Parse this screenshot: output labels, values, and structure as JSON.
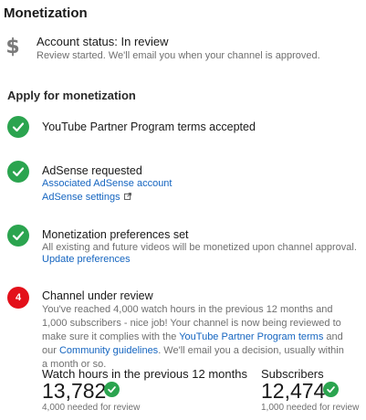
{
  "header": {
    "title": "Monetization"
  },
  "account": {
    "icon": "dollar-icon",
    "status": "Account status: In review",
    "description": "Review started. We'll email you when your channel is approved."
  },
  "apply": {
    "heading": "Apply for monetization",
    "steps": [
      {
        "title": "YouTube Partner Program terms accepted",
        "state": "complete"
      },
      {
        "title": "AdSense requested",
        "state": "complete",
        "links": [
          "Associated AdSense account",
          "AdSense settings"
        ]
      },
      {
        "title": "Monetization preferences set",
        "state": "complete",
        "description": "All existing and future videos will be monetized upon channel approval.",
        "link": "Update preferences"
      },
      {
        "title": "Channel under review",
        "state": "in-progress",
        "step_number": "4",
        "description_part1": "You've reached 4,000 watch hours in the previous 12 months and 1,000 subscribers - nice job! Your channel is now being reviewed to make sure it complies with the",
        "link_terms": "YouTube Partner Program terms",
        "description_part2": "and our",
        "link_guidelines": "Community guidelines",
        "description_part3": ". We'll email you a decision, usually within a month or so."
      }
    ]
  },
  "stats": {
    "watch_hours": {
      "label": "Watch hours in the previous 12 months",
      "value": "13,782",
      "needed": "4,000 needed for review"
    },
    "subscribers": {
      "label": "Subscribers",
      "value": "12,474",
      "needed": "1,000 needed for review"
    }
  },
  "colors": {
    "success_green": "#2ba44f",
    "link_blue": "#1565c0",
    "alert_red": "#e3101a"
  }
}
